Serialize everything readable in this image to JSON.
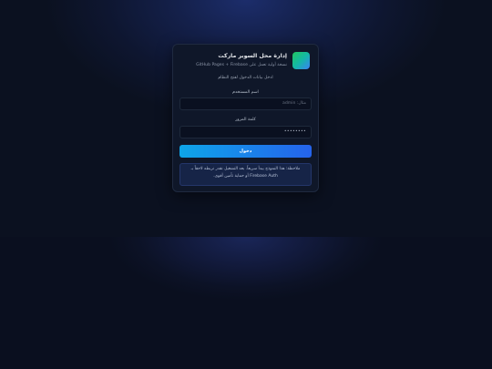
{
  "app": {
    "title": "إدارة محل السوبر ماركت",
    "subtitle": "نسخة أولية تعمل على GitHub Pages + Firebase"
  },
  "login": {
    "hint": "ادخل بيانات الدخول لفتح النظام",
    "username_label": "اسم المستخدم",
    "username_placeholder": "مثال: admin",
    "password_label": "كلمة المرور",
    "password_value": "••••••••",
    "submit_label": "دخول"
  },
  "note": {
    "line1": "ملاحظة: هذا النموذج يبدأ سريعاً. بعد التشغيل نقدر نربطه لاحقاً بـ",
    "line2": "Firebase Auth أو حماية تأمين أقوى."
  },
  "colors": {
    "accent_start": "#0ea5e9",
    "accent_end": "#2563eb",
    "card_bg": "#0f1729",
    "page_bg": "#0b1120"
  }
}
